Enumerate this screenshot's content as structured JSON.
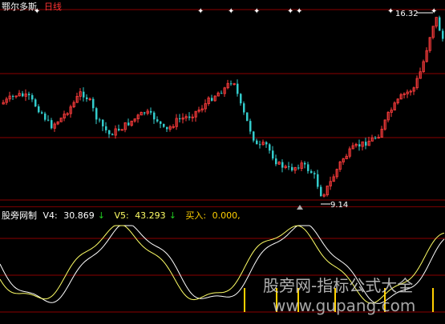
{
  "header": {
    "stock_name": "鄂尔多斯",
    "period": "日线"
  },
  "main_chart": {
    "high_label": "16.32",
    "low_label": "9.14",
    "bull_color": "#ff3c3c",
    "bear_color": "#33cccc",
    "grid_color": "#8b0000",
    "marker_icon": "star-marker-icon"
  },
  "indicator": {
    "name": "股旁网制",
    "v4_label": "V4:",
    "v4_value": "30.869",
    "v5_label": "V5:",
    "v5_value": "43.293",
    "buy_label": "买入:",
    "buy_value": "0.000,",
    "down_arrow": "↓",
    "v4_color": "#ffffff",
    "v5_color": "#ffff66",
    "buy_color": "#ffd000"
  },
  "watermark": {
    "line1": "股旁网-指标公式大全",
    "line2": "www.gupang.com"
  },
  "chart_data": {
    "type": "candlestick",
    "title": "",
    "xlabel": "",
    "ylabel": "",
    "price_high": 16.32,
    "price_low": 9.14
  }
}
